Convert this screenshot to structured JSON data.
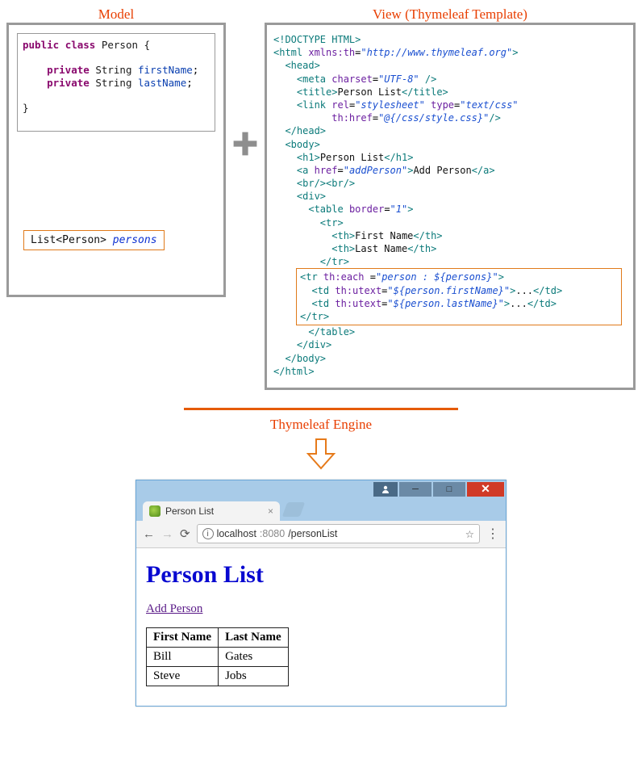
{
  "labels": {
    "model": "Model",
    "view": "View (Thymeleaf Template)",
    "engine": "Thymeleaf Engine"
  },
  "model": {
    "line1_kw1": "public",
    "line1_kw2": "class",
    "line1_cls": "Person {",
    "line2_kw": "private",
    "line2_type": "String",
    "line2_fld": "firstName",
    "line3_kw": "private",
    "line3_type": "String",
    "line3_fld": "lastName",
    "close": "}",
    "list_type": "List<Person>",
    "list_var": "persons"
  },
  "view": {
    "l1": "<!DOCTYPE HTML>",
    "l2a": "<html",
    "l2b": "xmlns:th",
    "l2c": "\"http://www.thymeleaf.org\"",
    "l3": "<head>",
    "l4a": "<meta",
    "l4b": "charset",
    "l4c": "\"UTF-8\"",
    "l5a": "<title>",
    "l5b": "Person List",
    "l5c": "</title>",
    "l6a": "<link",
    "l6b": "rel",
    "l6c": "\"stylesheet\"",
    "l6d": "type",
    "l6e": "\"text/css\"",
    "l7a": "th:href",
    "l7b": "\"@{/css/style.css}\"",
    "l8": "</head>",
    "l9": "<body>",
    "l10a": "<h1>",
    "l10b": "Person List",
    "l10c": "</h1>",
    "l11a": "<a",
    "l11b": "href",
    "l11c": "\"addPerson\"",
    "l11d": "Add Person",
    "l11e": "</a>",
    "l12": "<br/><br/>",
    "l13": "<div>",
    "l14a": "<table",
    "l14b": "border",
    "l14c": "\"1\"",
    "l15": "<tr>",
    "l16a": "<th>",
    "l16b": "First Name",
    "l16c": "</th>",
    "l17a": "<th>",
    "l17b": "Last Name",
    "l17c": "</th>",
    "l18": "</tr>",
    "hl1a": "<tr",
    "hl1b": "th:each",
    "hl1c": "=",
    "hl1d": "\"person : ${persons}\"",
    "hl2a": "<td",
    "hl2b": "th:utext",
    "hl2c": "\"${person.firstName}\"",
    "hl2d": "...",
    "hl2e": "</td>",
    "hl3a": "<td",
    "hl3b": "th:utext",
    "hl3c": "\"${person.lastName}\"",
    "hl3d": "...",
    "hl3e": "</td>",
    "hl4": "</tr>",
    "l19": "</table>",
    "l20": "</div>",
    "l21": "</body>",
    "l22": "</html>"
  },
  "browser": {
    "tab_title": "Person List",
    "url_host": "localhost",
    "url_port": ":8080",
    "url_path": "/personList",
    "page_h1": "Person List",
    "add_link": "Add Person",
    "th_first": "First Name",
    "th_last": "Last Name",
    "rows": [
      {
        "first": "Bill",
        "last": "Gates"
      },
      {
        "first": "Steve",
        "last": "Jobs"
      }
    ]
  }
}
